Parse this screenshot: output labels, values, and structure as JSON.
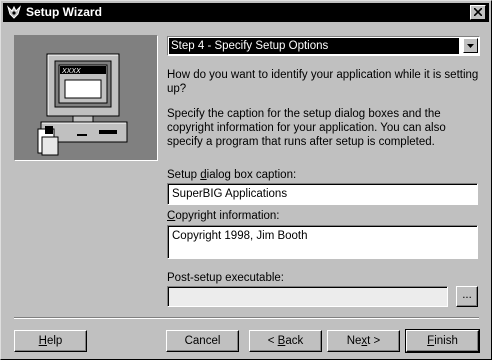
{
  "window": {
    "title": "Setup Wizard"
  },
  "step": {
    "selected": "Step 4 - Specify Setup Options"
  },
  "intro": {
    "question": "How do you want to identify your application while it is setting up?",
    "explanation": "Specify the caption for the setup dialog boxes and the copyright information for your application.  You can also specify a program that runs after setup is completed."
  },
  "caption": {
    "label_pre": "Setup ",
    "label_key": "d",
    "label_post": "ialog box caption:",
    "value": "SuperBIG Applications"
  },
  "copyright": {
    "label_key": "C",
    "label_post": "opyright information:",
    "value": "Copyright 1998, Jim Booth"
  },
  "post_setup": {
    "label": "Post-setup executable:",
    "value": "",
    "browse_label": "..."
  },
  "buttons": {
    "help_key": "H",
    "help_rest": "elp",
    "cancel": "Cancel",
    "back_arrow": "< ",
    "back_key": "B",
    "back_rest": "ack",
    "next_pre": "Ne",
    "next_key": "x",
    "next_post": "t >",
    "finish_key": "F",
    "finish_rest": "inish"
  },
  "illustration": {
    "screen_text": "XXXX"
  }
}
